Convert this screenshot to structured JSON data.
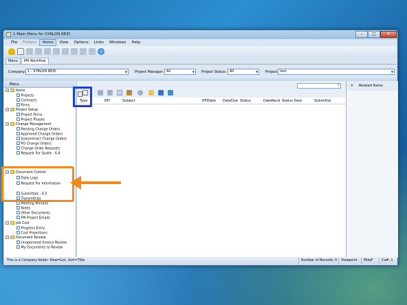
{
  "window": {
    "title": "1 Main Menu for SYBLON REID",
    "controls": {
      "minimize": "–",
      "maximize": "□",
      "close": "✕"
    }
  },
  "menubar": [
    "File",
    "Folders",
    "Items",
    "View",
    "Options",
    "Links",
    "Windows",
    "Help"
  ],
  "tabs": [
    "Menu",
    "PM Workflow"
  ],
  "filters": {
    "company_label": "Company:",
    "company_value": "1 - SYBLON REID",
    "pm_label": "Project Manager:",
    "pm_value": "All",
    "status_label": "Project Status:",
    "status_value": "All",
    "project_label": "Project:",
    "project_value": "test"
  },
  "sidebar": {
    "header": "Menu",
    "items_folder": "Items",
    "items": [
      "Projects",
      "Contracts",
      "Firms"
    ],
    "project_setup": "Project Setup",
    "project_setup_items": [
      "Project Firms",
      "Project Phases"
    ],
    "change_management": "Change Management",
    "change_items": [
      "Pending Change Orders",
      "Approved Change Orders",
      "Subcontract Change Orders",
      "PO Change Orders",
      "Change Order Requests",
      "Request For Quote - 6.6"
    ],
    "document_control": "Document Control",
    "document_items": [
      "Daily Logs",
      "Request For Information",
      "Submittals - 6.5",
      "Transmittals",
      "Meeting Minutes",
      "Notes",
      "Other Documents",
      "FM Project Emails"
    ],
    "job_cost": "Job Cost",
    "job_cost_items": [
      "Progress Entry",
      "Cost Projections"
    ],
    "document_review": "Document Review",
    "document_review_items": [
      "Unapproved Invoice Review",
      "My Documents to Review"
    ]
  },
  "grid": {
    "columns": [
      "Type",
      "RFI",
      "Subject",
      "RFIDate",
      "DateDue",
      "Status",
      "DateRecd",
      "Status Desc",
      "Submittal"
    ]
  },
  "right_panel": {
    "title": "Related Items",
    "chevron": "»"
  },
  "statusbar": {
    "message": "This is a Company folder.  View=List, Sort=Title.",
    "records": "Number of Records: 0",
    "app": "Viewpoint",
    "user": "MikeF",
    "co": "Co#: 1"
  },
  "colors": {
    "highlight_blue": "#1f3fd0",
    "highlight_orange": "#f08a1c"
  }
}
